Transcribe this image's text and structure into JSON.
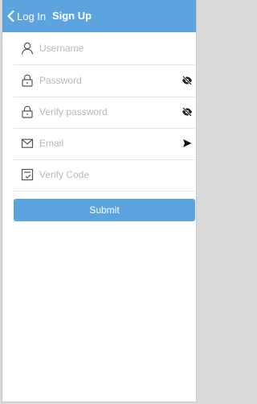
{
  "header": {
    "back_label": "Log In",
    "title": "Sign Up",
    "background": "#5ba4e0",
    "back_icon": "chevron-left-icon"
  },
  "form": {
    "username": {
      "placeholder": "Username",
      "icon": "user-icon"
    },
    "password": {
      "placeholder": "Password",
      "icon": "lock-icon",
      "trailing_icon": "eye-slash-icon"
    },
    "verify_password": {
      "placeholder": "Verify password",
      "icon": "lock-icon",
      "trailing_icon": "eye-slash-icon"
    },
    "email": {
      "placeholder": "Email",
      "icon": "mail-icon",
      "trailing_icon": "send-icon"
    },
    "verify_code": {
      "placeholder": "Verify Code",
      "icon": "verify-code-icon"
    }
  },
  "submit": {
    "label": "Submit",
    "background": "#5ba4e0"
  }
}
